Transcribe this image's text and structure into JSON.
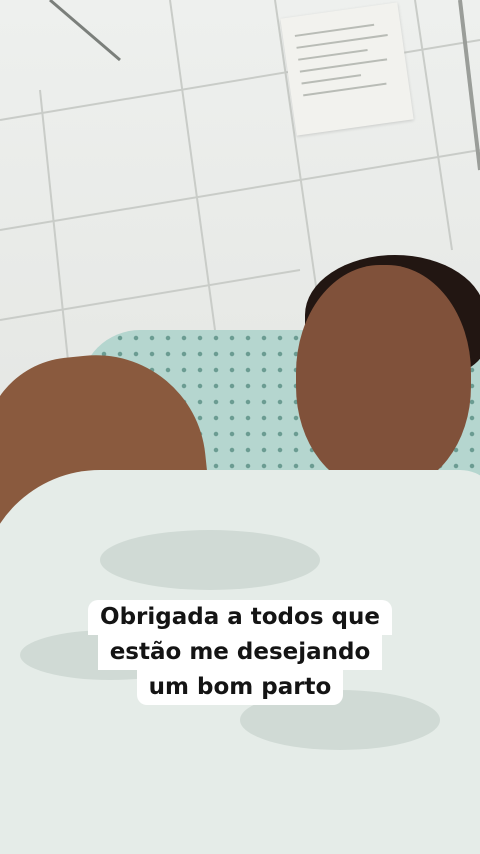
{
  "caption": {
    "line1": "Obrigada a todos que",
    "line2": "estão me desejando",
    "line3": "um bom parto"
  },
  "colors": {
    "wall": "#e6e8e5",
    "gown": "#b5d6cf",
    "gown_dots": "#6b9c92",
    "sheet": "#e5ece8",
    "caption_bg": "#ffffff",
    "caption_text": "#141414"
  }
}
